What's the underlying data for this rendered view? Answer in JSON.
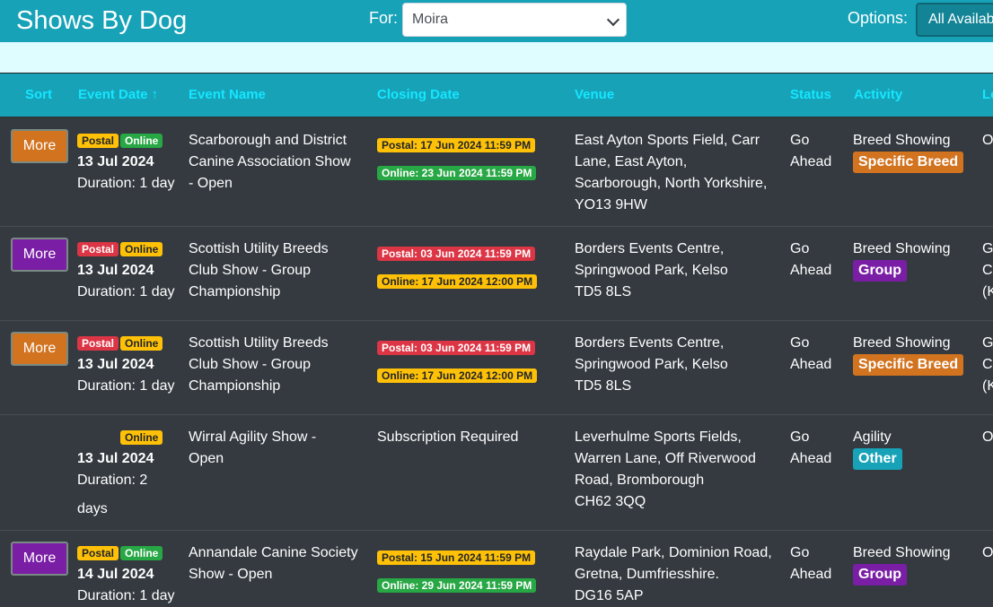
{
  "header": {
    "title": "Shows By Dog",
    "for_label": "For:",
    "dog_selected": "Moira",
    "options_label": "Options:",
    "options_button": "All Available"
  },
  "colors": {
    "header_bg": "#17a2b8",
    "header_text": "#14e7ff",
    "table_bg": "#343a40",
    "more_orange": "#d2731f",
    "more_purple": "#7a1ea6",
    "badge_yellow": "#ffc107",
    "badge_green": "#28a745",
    "badge_red": "#dc3545"
  },
  "columns": {
    "sort": "Sort",
    "event_date": "Event Date",
    "event_date_sort_icon": "↑",
    "event_name": "Event Name",
    "closing_date": "Closing Date",
    "venue": "Venue",
    "status": "Status",
    "activity": "Activity",
    "level": "Le"
  },
  "rows": [
    {
      "more": "More",
      "badges": [
        "Postal",
        "Online"
      ],
      "date": "13 Jul 2024",
      "duration": "Duration: 1 day",
      "name": [
        "Scarborough and District",
        "Canine Association Show",
        "- Open"
      ],
      "closing": [
        "Postal: 17 Jun 2024 11:59 PM",
        "Online: 23 Jun 2024 11:59 PM"
      ],
      "venue": [
        "East Ayton Sports Field, Carr",
        "Lane, East Ayton,",
        "Scarborough, North Yorkshire,",
        "YO13 9HW"
      ],
      "status": [
        "Go",
        "Ahead"
      ],
      "activity": "Breed Showing",
      "activity_badge": "Specific Breed",
      "level": [
        "O"
      ]
    },
    {
      "more": "More",
      "badges": [
        "Postal",
        "Online"
      ],
      "date": "13 Jul 2024",
      "duration": "Duration: 1 day",
      "name": [
        "Scottish Utility Breeds",
        "Club Show - Group",
        "Championship"
      ],
      "closing": [
        "Postal: 03 Jun 2024 11:59 PM",
        "Online: 17 Jun 2024 12:00 PM"
      ],
      "venue": [
        "Borders Events Centre,",
        "Springwood Park, Kelso",
        "TD5 8LS"
      ],
      "status": [
        "Go",
        "Ahead"
      ],
      "activity": "Breed Showing",
      "activity_badge": "Group",
      "level": [
        "G",
        "C",
        "(K"
      ]
    },
    {
      "more": "More",
      "badges": [
        "Postal",
        "Online"
      ],
      "date": "13 Jul 2024",
      "duration": "Duration: 1 day",
      "name": [
        "Scottish Utility Breeds",
        "Club Show - Group",
        "Championship"
      ],
      "closing": [
        "Postal: 03 Jun 2024 11:59 PM",
        "Online: 17 Jun 2024 12:00 PM"
      ],
      "venue": [
        "Borders Events Centre,",
        "Springwood Park, Kelso",
        "TD5 8LS"
      ],
      "status": [
        "Go",
        "Ahead"
      ],
      "activity": "Breed Showing",
      "activity_badge": "Specific Breed",
      "level": [
        "G",
        "C",
        "(K"
      ]
    },
    {
      "badges": [
        "Online"
      ],
      "date": "13 Jul 2024",
      "duration_lines": [
        "Duration: 2",
        "days"
      ],
      "name": [
        "Wirral Agility Show -",
        "Open"
      ],
      "closing_text": "Subscription Required",
      "venue": [
        "Leverhulme Sports Fields,",
        "Warren Lane, Off Riverwood",
        "Road, Bromborough",
        "CH62 3QQ"
      ],
      "status": [
        "Go",
        "Ahead"
      ],
      "activity": "Agility",
      "activity_badge": "Other",
      "level": [
        "O"
      ]
    },
    {
      "more": "More",
      "badges": [
        "Postal",
        "Online"
      ],
      "date": "14 Jul 2024",
      "duration": "Duration: 1 day",
      "name": [
        "Annandale Canine Society",
        "Show - Open"
      ],
      "closing": [
        "Postal: 15 Jun 2024 11:59 PM",
        "Online: 29 Jun 2024 11:59 PM"
      ],
      "venue": [
        "Raydale Park, Dominion Road,",
        "Gretna, Dumfriesshire.",
        "DG16 5AP"
      ],
      "status": [
        "Go",
        "Ahead"
      ],
      "activity": "Breed Showing",
      "activity_badge": "Group",
      "level": [
        "O"
      ]
    }
  ]
}
